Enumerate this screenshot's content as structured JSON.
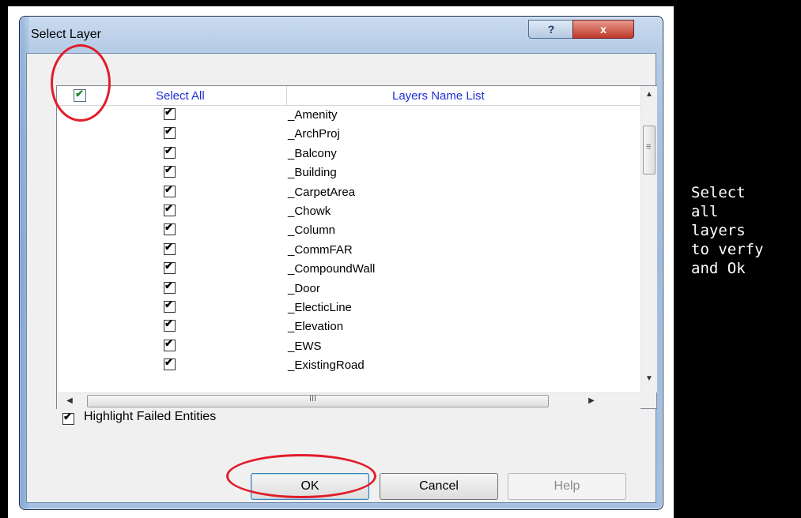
{
  "window": {
    "title": "Select Layer",
    "help_button": "?",
    "close_button": "x"
  },
  "listview": {
    "header": {
      "select_all_label": "Select All",
      "layers_label": "Layers Name List",
      "select_all_checked": true
    },
    "rows": [
      {
        "name": "_Amenity",
        "checked": true
      },
      {
        "name": "_ArchProj",
        "checked": true
      },
      {
        "name": "_Balcony",
        "checked": true
      },
      {
        "name": "_Building",
        "checked": true
      },
      {
        "name": "_CarpetArea",
        "checked": true
      },
      {
        "name": "_Chowk",
        "checked": true
      },
      {
        "name": "_Column",
        "checked": true
      },
      {
        "name": "_CommFAR",
        "checked": true
      },
      {
        "name": "_CompoundWall",
        "checked": true
      },
      {
        "name": "_Door",
        "checked": true
      },
      {
        "name": "_ElecticLine",
        "checked": true
      },
      {
        "name": "_Elevation",
        "checked": true
      },
      {
        "name": "_EWS",
        "checked": true
      },
      {
        "name": "_ExistingRoad",
        "checked": true
      }
    ],
    "vscroll_thumb_glyph": "≡",
    "hscroll_thumb_glyph": "III"
  },
  "options": {
    "highlight_label": "Highlight Failed Entities",
    "highlight_checked": true
  },
  "buttons": {
    "ok": "OK",
    "cancel": "Cancel",
    "help": "Help"
  },
  "caption": {
    "lines": [
      "Select",
      "all",
      "layers",
      "to verfy",
      "and Ok"
    ]
  },
  "colors": {
    "annotation": "#e11d2a",
    "header_text": "#1f2fd8",
    "sidebar": "#000000"
  }
}
